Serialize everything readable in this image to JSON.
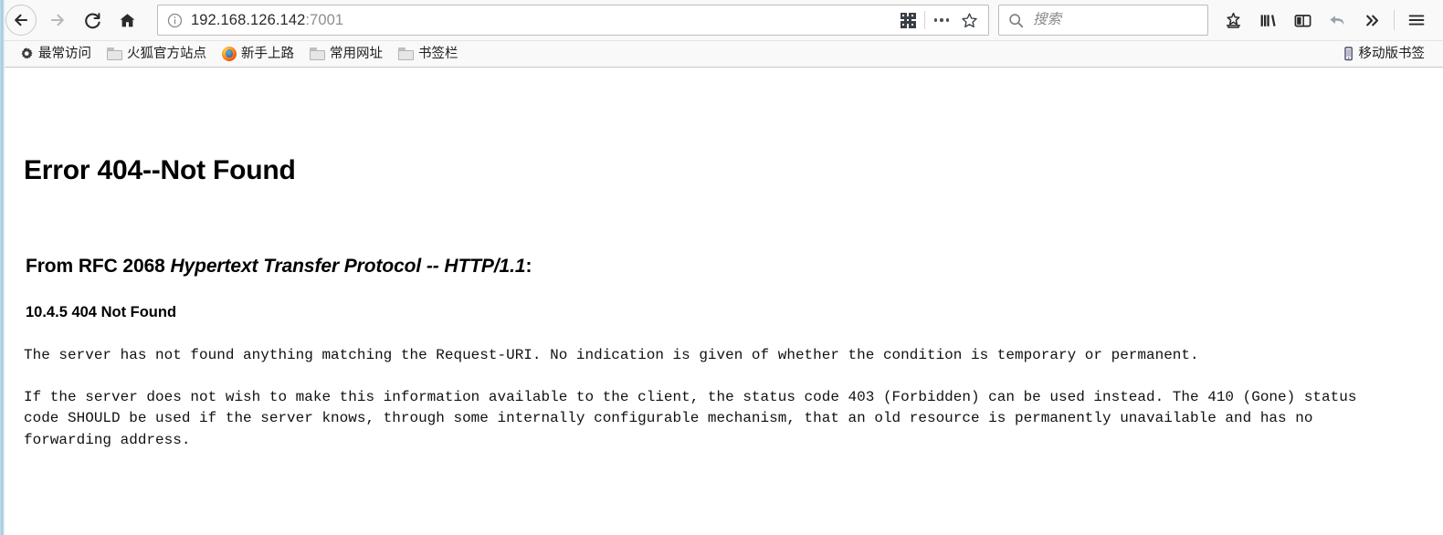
{
  "browser": {
    "nav": {
      "back": {
        "label": "Back",
        "icon": "arrow-left-icon",
        "enabled": true
      },
      "forward": {
        "label": "Forward",
        "icon": "arrow-right-icon",
        "enabled": false
      },
      "reload": {
        "label": "Reload",
        "icon": "reload-icon"
      },
      "home": {
        "label": "Home",
        "icon": "home-icon"
      }
    },
    "urlbar": {
      "host": "192.168.126.142",
      "port": ":7001",
      "full_url": "192.168.126.142:7001",
      "info_icon": "page-info-icon",
      "qr_icon": "qr-code-icon",
      "more_icon": "page-actions-icon",
      "bookmark_icon": "star-icon"
    },
    "search": {
      "placeholder": "搜索",
      "value": "",
      "icon": "search-icon"
    },
    "toolbar_icons": [
      {
        "name": "save-to-pocket-icon",
        "title": "Save to Pocket"
      },
      {
        "name": "library-icon",
        "title": "Library"
      },
      {
        "name": "sidebar-icon",
        "title": "Sidebars"
      },
      {
        "name": "sync-icon",
        "title": "Synced Tabs"
      },
      {
        "name": "overflow-icon",
        "title": "More Tools"
      },
      {
        "name": "hamburger-menu-icon",
        "title": "Open Menu"
      }
    ],
    "bookmarks": {
      "items": [
        {
          "label": "最常访问",
          "icon": "gear-icon"
        },
        {
          "label": "火狐官方站点",
          "icon": "folder-icon"
        },
        {
          "label": "新手上路",
          "icon": "firefox-icon"
        },
        {
          "label": "常用网址",
          "icon": "folder-icon"
        },
        {
          "label": "书签栏",
          "icon": "folder-icon"
        }
      ],
      "mobile": {
        "label": "移动版书签",
        "icon": "mobile-phone-icon"
      }
    }
  },
  "page": {
    "title": "Error 404--Not Found",
    "rfc_prefix": "From RFC 2068 ",
    "rfc_title": "Hypertext Transfer Protocol -- HTTP/1.1",
    "rfc_suffix": ":",
    "section": "10.4.5 404 Not Found",
    "paragraphs": [
      "The server has not found anything matching the Request-URI. No indication is given of whether the condition is temporary or permanent.",
      "If the server does not wish to make this information available to the client, the status code 403 (Forbidden) can be used instead. The 410 (Gone) status code SHOULD be used if the server knows, through some internally configurable mechanism, that an old resource is permanently unavailable and has no forwarding address."
    ]
  },
  "colors": {
    "chrome_bg": "#f9f9fa",
    "page_bg": "#ffffff",
    "text": "#111111",
    "url_port": "#8e8e8e"
  }
}
